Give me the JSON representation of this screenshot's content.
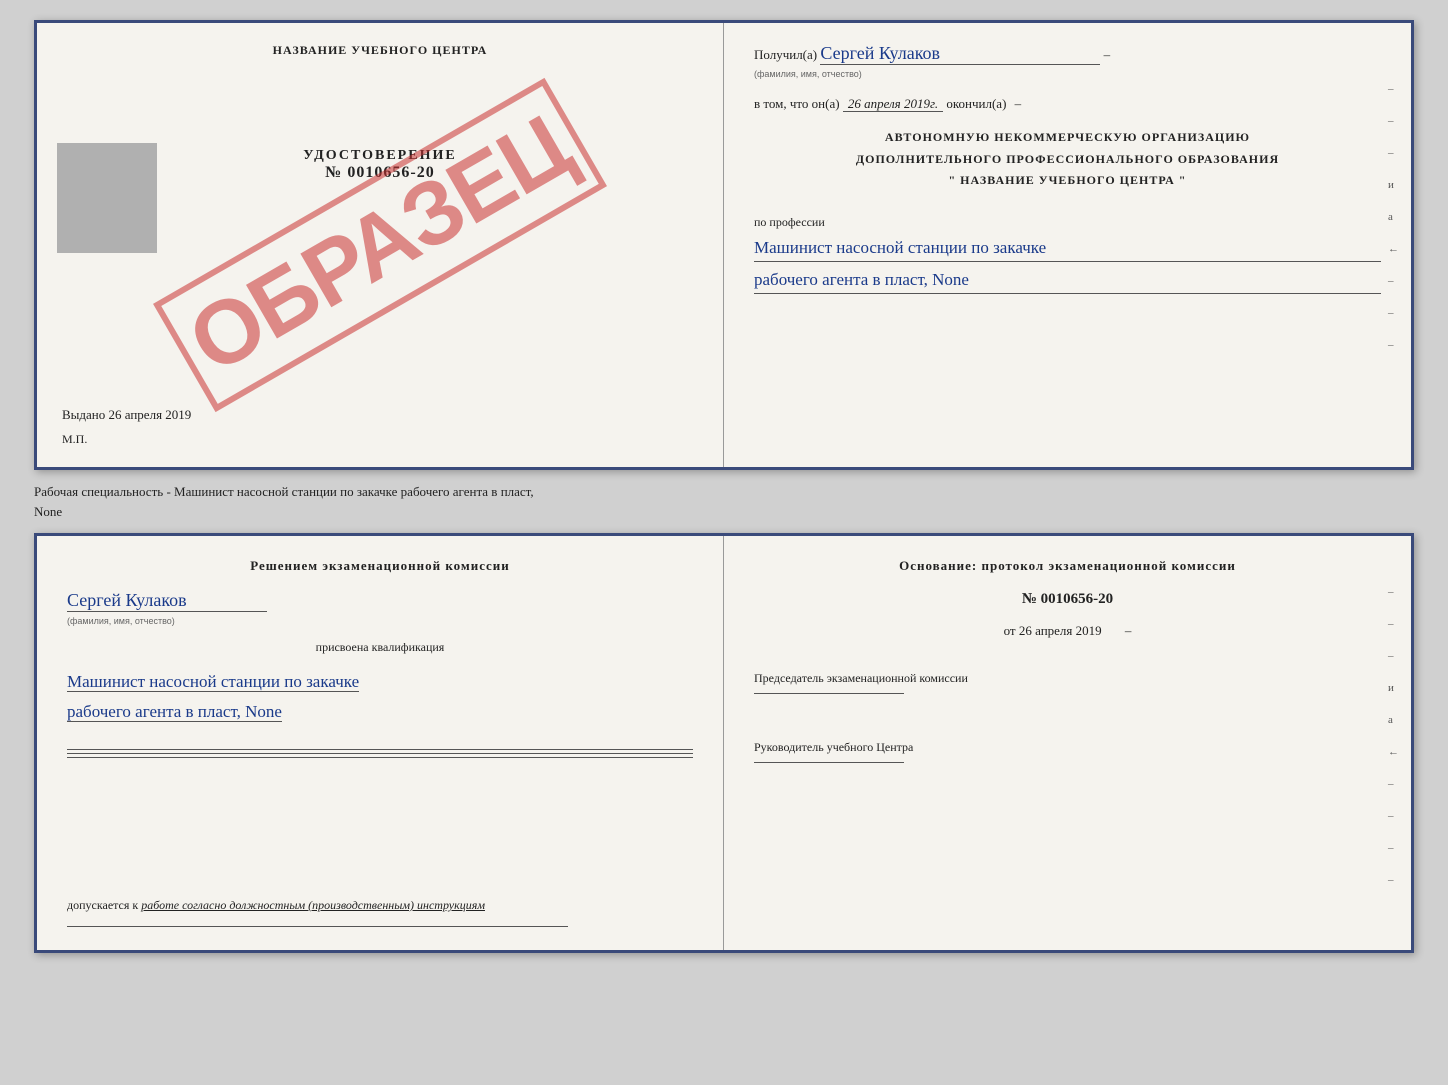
{
  "topDoc": {
    "left": {
      "centerTitle": "НАЗВАНИЕ УЧЕБНОГО ЦЕНТРА",
      "udostoverenie": "УДОСТОВЕРЕНИЕ",
      "number": "№ 0010656-20",
      "stampText": "ОБРАЗЕЦ",
      "vydano": "Выдано",
      "vydanoDate": "26 апреля 2019",
      "mpLabel": "М.П."
    },
    "right": {
      "poluchilLabel": "Получил(а)",
      "poluchilName": "Сергей Кулаков",
      "fioHint": "(фамилия, имя, отчество)",
      "dash1": "–",
      "vtomLabel": "в том, что он(а)",
      "vtomDate": "26 апреля 2019г.",
      "okonchilLabel": "окончил(а)",
      "orgLine1": "АВТОНОМНУЮ НЕКОММЕРЧЕСКУЮ ОРГАНИЗАЦИЮ",
      "orgLine2": "ДОПОЛНИТЕЛЬНОГО ПРОФЕССИОНАЛЬНОГО ОБРАЗОВАНИЯ",
      "orgLine3": "\" НАЗВАНИЕ УЧЕБНОГО ЦЕНТРА \"",
      "poProfilessiiLabel": "по профессии",
      "profession1": "Машинист насосной станции по закачке",
      "profession2": "рабочего агента в пласт, None",
      "sideMarks": [
        "-",
        "-",
        "-",
        "и",
        "а",
        "←",
        "-",
        "-",
        "-"
      ]
    }
  },
  "middleText": {
    "line1": "Рабочая специальность - Машинист насосной станции по закачке рабочего агента в пласт,",
    "line2": "None"
  },
  "bottomDoc": {
    "left": {
      "decisionTitle": "Решением  экзаменационной  комиссии",
      "name": "Сергей Кулаков",
      "fioHint": "(фамилия, имя, отчество)",
      "prisvoenaLabel": "присвоена квалификация",
      "qualification1": "Машинист насосной станции по закачке",
      "qualification2": "рабочего агента в пласт, None",
      "dopuskaetsya": "допускается к",
      "dopuskWork": "работе согласно должностным (производственным) инструкциям"
    },
    "right": {
      "osnovanie": "Основание: протокол экзаменационной  комиссии",
      "protocolNumber": "№ 0010656-20",
      "protocolDatePrefix": "от",
      "protocolDate": "26 апреля 2019",
      "predsedatelLabel": "Председатель экзаменационной комиссии",
      "rukovoditelLabel": "Руководитель учебного Центра",
      "sideMarks": [
        "-",
        "-",
        "-",
        "и",
        "а",
        "←",
        "-",
        "-",
        "-",
        "-"
      ]
    }
  }
}
